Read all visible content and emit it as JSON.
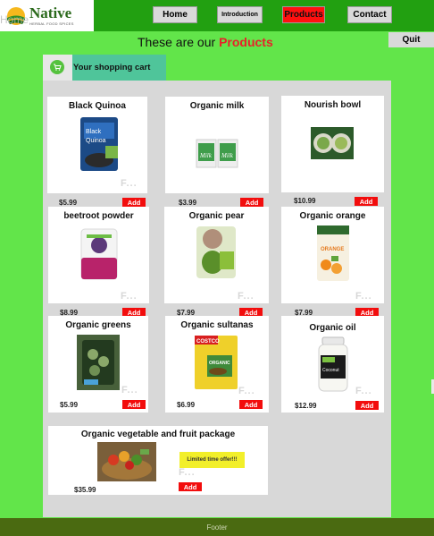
{
  "brand": {
    "name": "Native",
    "tagline": "HERBAL FOOD SPICES",
    "overlay_text": "Home"
  },
  "nav": [
    {
      "label": "Home",
      "active": false
    },
    {
      "label": "Introduction",
      "active": false
    },
    {
      "label": "Products",
      "active": true
    },
    {
      "label": "Contact",
      "active": false
    }
  ],
  "heading": {
    "prefix": "These are our",
    "highlight": "Products"
  },
  "quit_label": "Quit",
  "cart": {
    "label": "Your shopping cart"
  },
  "add_label": "Add",
  "fave_label": "F...",
  "products": [
    {
      "name": "Black Quinoa",
      "price": "$5.99"
    },
    {
      "name": "Organic milk",
      "price": "$3.99"
    },
    {
      "name": "Nourish bowl",
      "price": "$10.99"
    },
    {
      "name": "beetroot powder",
      "price": "$8.99"
    },
    {
      "name": "Organic pear",
      "price": "$7.99"
    },
    {
      "name": "Organic orange",
      "price": "$7.99"
    },
    {
      "name": "Organic greens",
      "price": "$5.99"
    },
    {
      "name": "Organic sultanas",
      "price": "$6.99"
    },
    {
      "name": "Organic oil",
      "price": "$12.99"
    },
    {
      "name": "Organic vegetable and fruit package",
      "price": "$35.99",
      "offer": "Limited time offer!!!"
    }
  ],
  "footer": "Footer",
  "colors": {
    "header": "#22a011",
    "page": "#62e54a",
    "active_nav": "#ff1010",
    "add_button": "#f20d0d",
    "cart_tab": "#4fc59a",
    "footer": "#4a6a11"
  }
}
